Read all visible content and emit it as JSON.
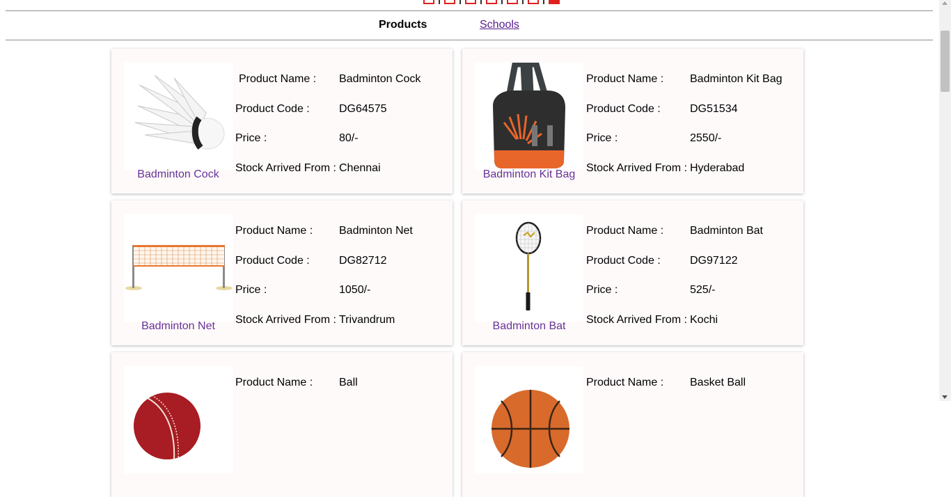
{
  "nav": {
    "active": "Products",
    "link": "Schools"
  },
  "labels": {
    "name": "Product Name :",
    "code": "Product Code :",
    "price": "Price :",
    "stock": "Stock Arrived From :"
  },
  "products": [
    {
      "caption": "Badminton Cock",
      "name": "Badminton Cock",
      "code": "DG64575",
      "price": "80/-",
      "stock": "Chennai",
      "image": "shuttlecock"
    },
    {
      "caption": "Badminton Kit Bag",
      "name": "Badminton Kit Bag",
      "code": "DG51534",
      "price": "2550/-",
      "stock": "Hyderabad",
      "image": "kit-bag"
    },
    {
      "caption": "Badminton Net",
      "name": "Badminton Net",
      "code": "DG82712",
      "price": "1050/-",
      "stock": "Trivandrum",
      "image": "net"
    },
    {
      "caption": "Badminton Bat",
      "name": "Badminton Bat",
      "code": "DG97122",
      "price": "525/-",
      "stock": "Kochi",
      "image": "racket"
    },
    {
      "name": "Ball",
      "image": "cricket-ball"
    },
    {
      "name": "Basket Ball",
      "image": "basketball"
    }
  ]
}
